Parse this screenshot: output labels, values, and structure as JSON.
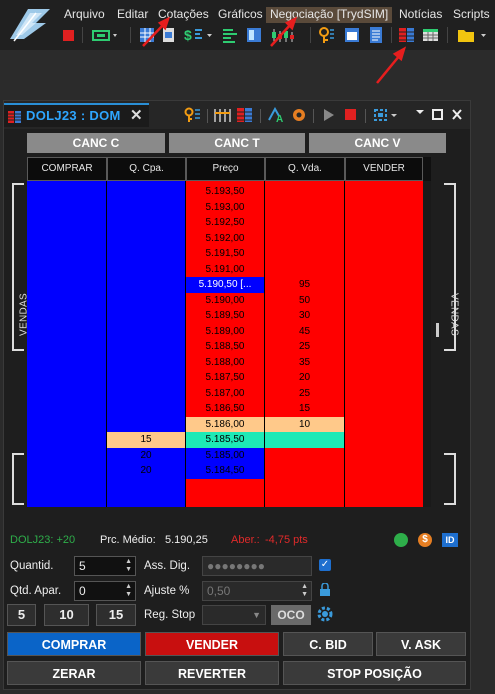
{
  "menu": {
    "items": [
      "Arquivo",
      "Editar",
      "Cotações",
      "Gráficos",
      "Negociação [TrydSIM]",
      "Notícias",
      "Scripts"
    ]
  },
  "window": {
    "tab_title": "DOLJ23 : DOM",
    "close": "✕"
  },
  "cancel": {
    "c": "CANC C",
    "t": "CANC T",
    "v": "CANC V"
  },
  "headers": {
    "comprar": "COMPRAR",
    "qcpa": "Q. Cpa.",
    "preco": "Preço",
    "qvda": "Q. Vda.",
    "vender": "VENDER"
  },
  "book": {
    "prices": [
      "5.193,50",
      "5.193,00",
      "5.192,50",
      "5.192,00",
      "5.191,50",
      "5.191,00",
      "5.190,50 [...",
      "5.190,00",
      "5.189,50",
      "5.189,00",
      "5.188,50",
      "5.188,00",
      "5.187,50",
      "5.187,00",
      "5.186,50",
      "5.186,00",
      "5.185,50",
      "5.185,00",
      "5.184,50"
    ],
    "qvda": [
      "",
      "",
      "",
      "",
      "",
      "",
      "95",
      "50",
      "30",
      "45",
      "25",
      "35",
      "20",
      "25",
      "15",
      "10",
      "",
      "",
      ""
    ],
    "qcpa": [
      "",
      "",
      "",
      "",
      "",
      "",
      "",
      "",
      "",
      "",
      "",
      "",
      "",
      "",
      "",
      "",
      "15",
      "20",
      "20"
    ]
  },
  "side_labels": {
    "left": "VENDAS",
    "right": "VENDAS"
  },
  "status": {
    "symbol_change": "DOLJ23: +20",
    "prc_medio_label": "Prc. Médio:",
    "prc_medio_value": "5.190,25",
    "aber_label": "Aber.:",
    "aber_value": "-4,75 pts",
    "id_badge": "ID",
    "dollar_badge": "$"
  },
  "form": {
    "quantid_label": "Quantid.",
    "quantid_value": "5",
    "qtd_apar_label": "Qtd. Apar.",
    "qtd_apar_value": "0",
    "ass_dig_label": "Ass. Dig.",
    "ass_dig_value": "●●●●●●●●",
    "ajuste_label": "Ajuste %",
    "ajuste_value": "0,50",
    "reg_stop_label": "Reg. Stop",
    "oco": "OCO",
    "q5": "5",
    "q10": "10",
    "q15": "15"
  },
  "actions": {
    "comprar": "COMPRAR",
    "vender": "VENDER",
    "cbid": "C. BID",
    "vask": "V. ASK",
    "zerar": "ZERAR",
    "reverter": "REVERTER",
    "stop": "STOP POSIÇÃO"
  },
  "colors": {
    "sell": "#ff0000",
    "buy": "#0000ff",
    "highlight": "#ffc98a",
    "cyan": "#1de9b6",
    "accent": "#2ea6ff"
  }
}
